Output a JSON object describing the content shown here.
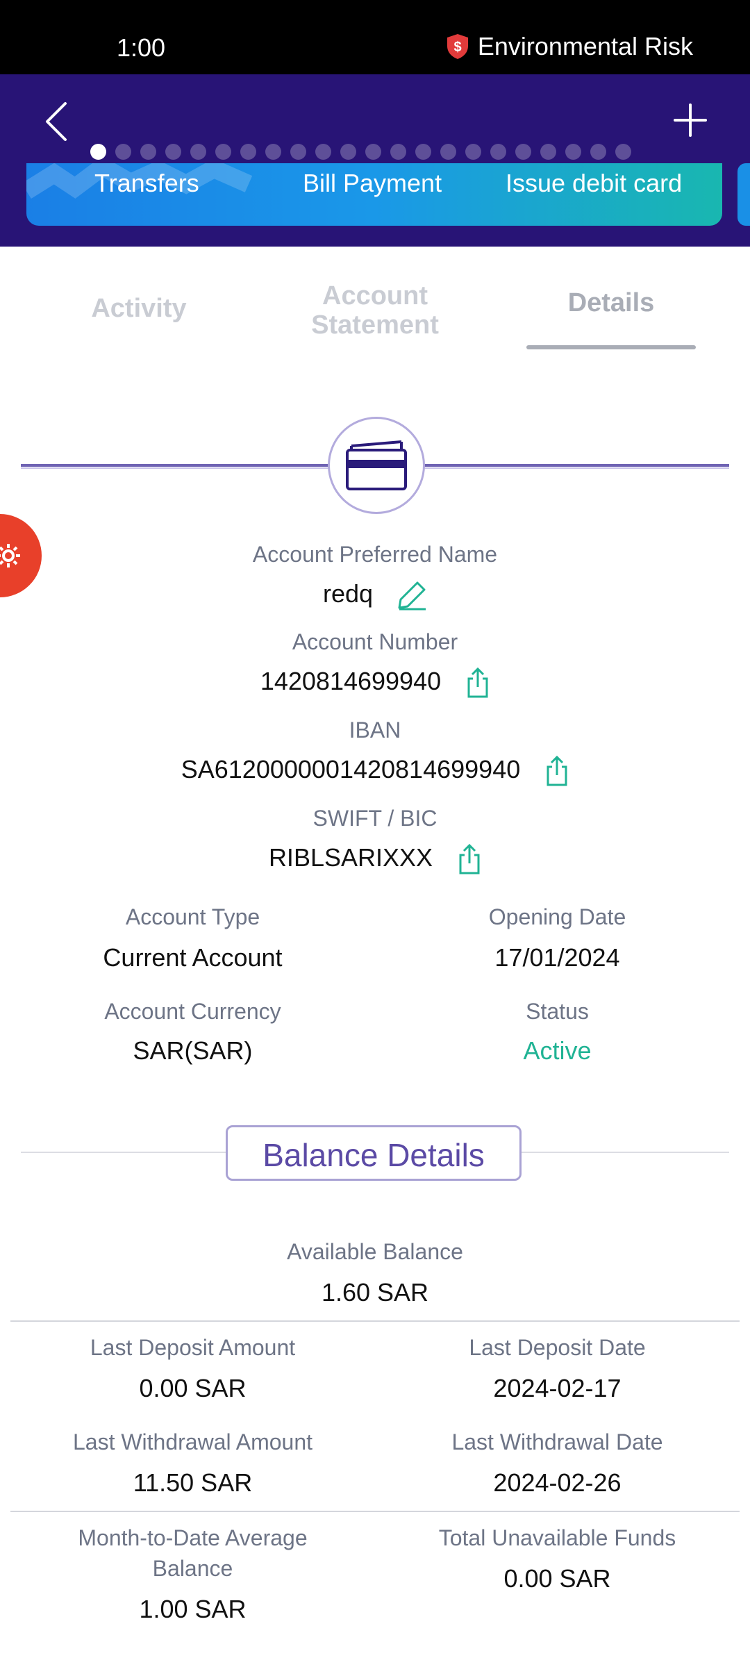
{
  "status_bar": {
    "time": "1:00",
    "alert_text": "Environmental Risk"
  },
  "header": {
    "quick_actions": [
      "Transfers",
      "Bill Payment",
      "Issue debit card"
    ],
    "page_indicator": {
      "total": 22,
      "active_index": 0
    }
  },
  "tabs": [
    {
      "label": "Activity",
      "active": false
    },
    {
      "label": "Account Statement",
      "active": false
    },
    {
      "label": "Details",
      "active": true
    }
  ],
  "account": {
    "preferred_name_label": "Account Preferred Name",
    "preferred_name": "redq",
    "number_label": "Account Number",
    "number": "1420814699940",
    "iban_label": "IBAN",
    "iban": "SA6120000001420814699940",
    "swift_label": "SWIFT / BIC",
    "swift": "RIBLSARIXXX",
    "type_label": "Account Type",
    "type": "Current Account",
    "opening_date_label": "Opening Date",
    "opening_date": "17/01/2024",
    "currency_label": "Account Currency",
    "currency": "SAR(SAR)",
    "status_label": "Status",
    "status": "Active"
  },
  "balance": {
    "section_title": "Balance Details",
    "available_label": "Available Balance",
    "available": "1.60 SAR",
    "last_deposit_amount_label": "Last Deposit Amount",
    "last_deposit_amount": "0.00 SAR",
    "last_deposit_date_label": "Last Deposit Date",
    "last_deposit_date": "2024-02-17",
    "last_withdrawal_amount_label": "Last Withdrawal Amount",
    "last_withdrawal_amount": "11.50 SAR",
    "last_withdrawal_date_label": "Last Withdrawal Date",
    "last_withdrawal_date": "2024-02-26",
    "mtd_avg_label": "Month-to-Date Average Balance",
    "mtd_avg": "1.00 SAR",
    "unavailable_label": "Total Unavailable Funds",
    "unavailable": "0.00 SAR"
  },
  "colors": {
    "header_bg": "#281476",
    "accent_green": "#20b394",
    "accent_purple": "#5b4aa5",
    "fab_red": "#e8402a"
  },
  "icons": [
    "shield-dollar-icon",
    "back-chevron-icon",
    "plus-icon",
    "card-icon",
    "gear-icon",
    "pencil-icon",
    "share-icon"
  ]
}
